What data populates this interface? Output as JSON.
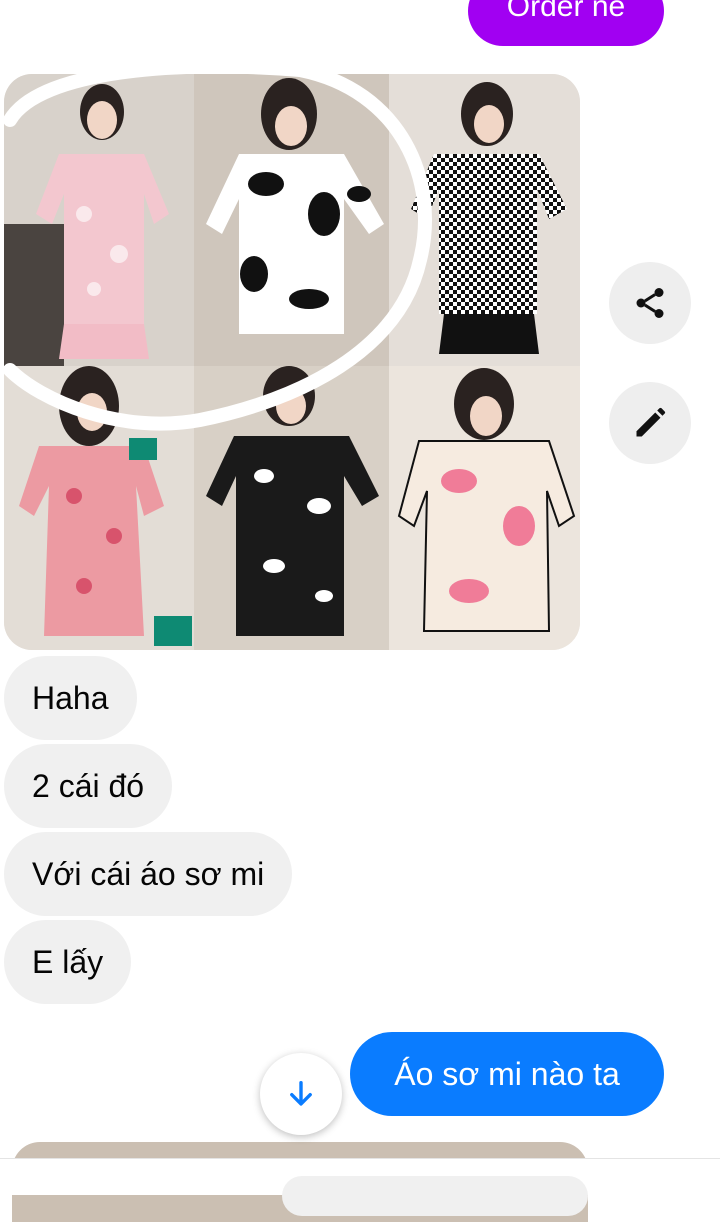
{
  "messages": {
    "outgoing_top": "Order nè",
    "incoming": [
      "Haha",
      "2 cái đó",
      "Với cái áo sơ mi",
      "E lấy"
    ],
    "outgoing_bottom": "Áo sơ mi nào ta"
  },
  "photo_grid": {
    "cells": [
      {
        "pattern": "pink-floral",
        "color": "#f3c7cf"
      },
      {
        "pattern": "cow-black-white",
        "color": "#ffffff"
      },
      {
        "pattern": "houndstooth",
        "color": "#d9d9d9"
      },
      {
        "pattern": "pink-hearts-green-trim",
        "color": "#ec9aa2"
      },
      {
        "pattern": "black-with-white-spots",
        "color": "#1a1a1a"
      },
      {
        "pattern": "pink-cow-cream",
        "color": "#f6ebe0"
      }
    ]
  },
  "icons": {
    "share": "share-icon",
    "edit": "pencil-icon",
    "scroll": "arrow-down-icon"
  },
  "colors": {
    "outgoing_top_bubble": "#a100f2",
    "outgoing_bubble": "#0a7cff",
    "incoming_bubble": "#f0f0f0",
    "annotation_circle": "#ffffff"
  }
}
